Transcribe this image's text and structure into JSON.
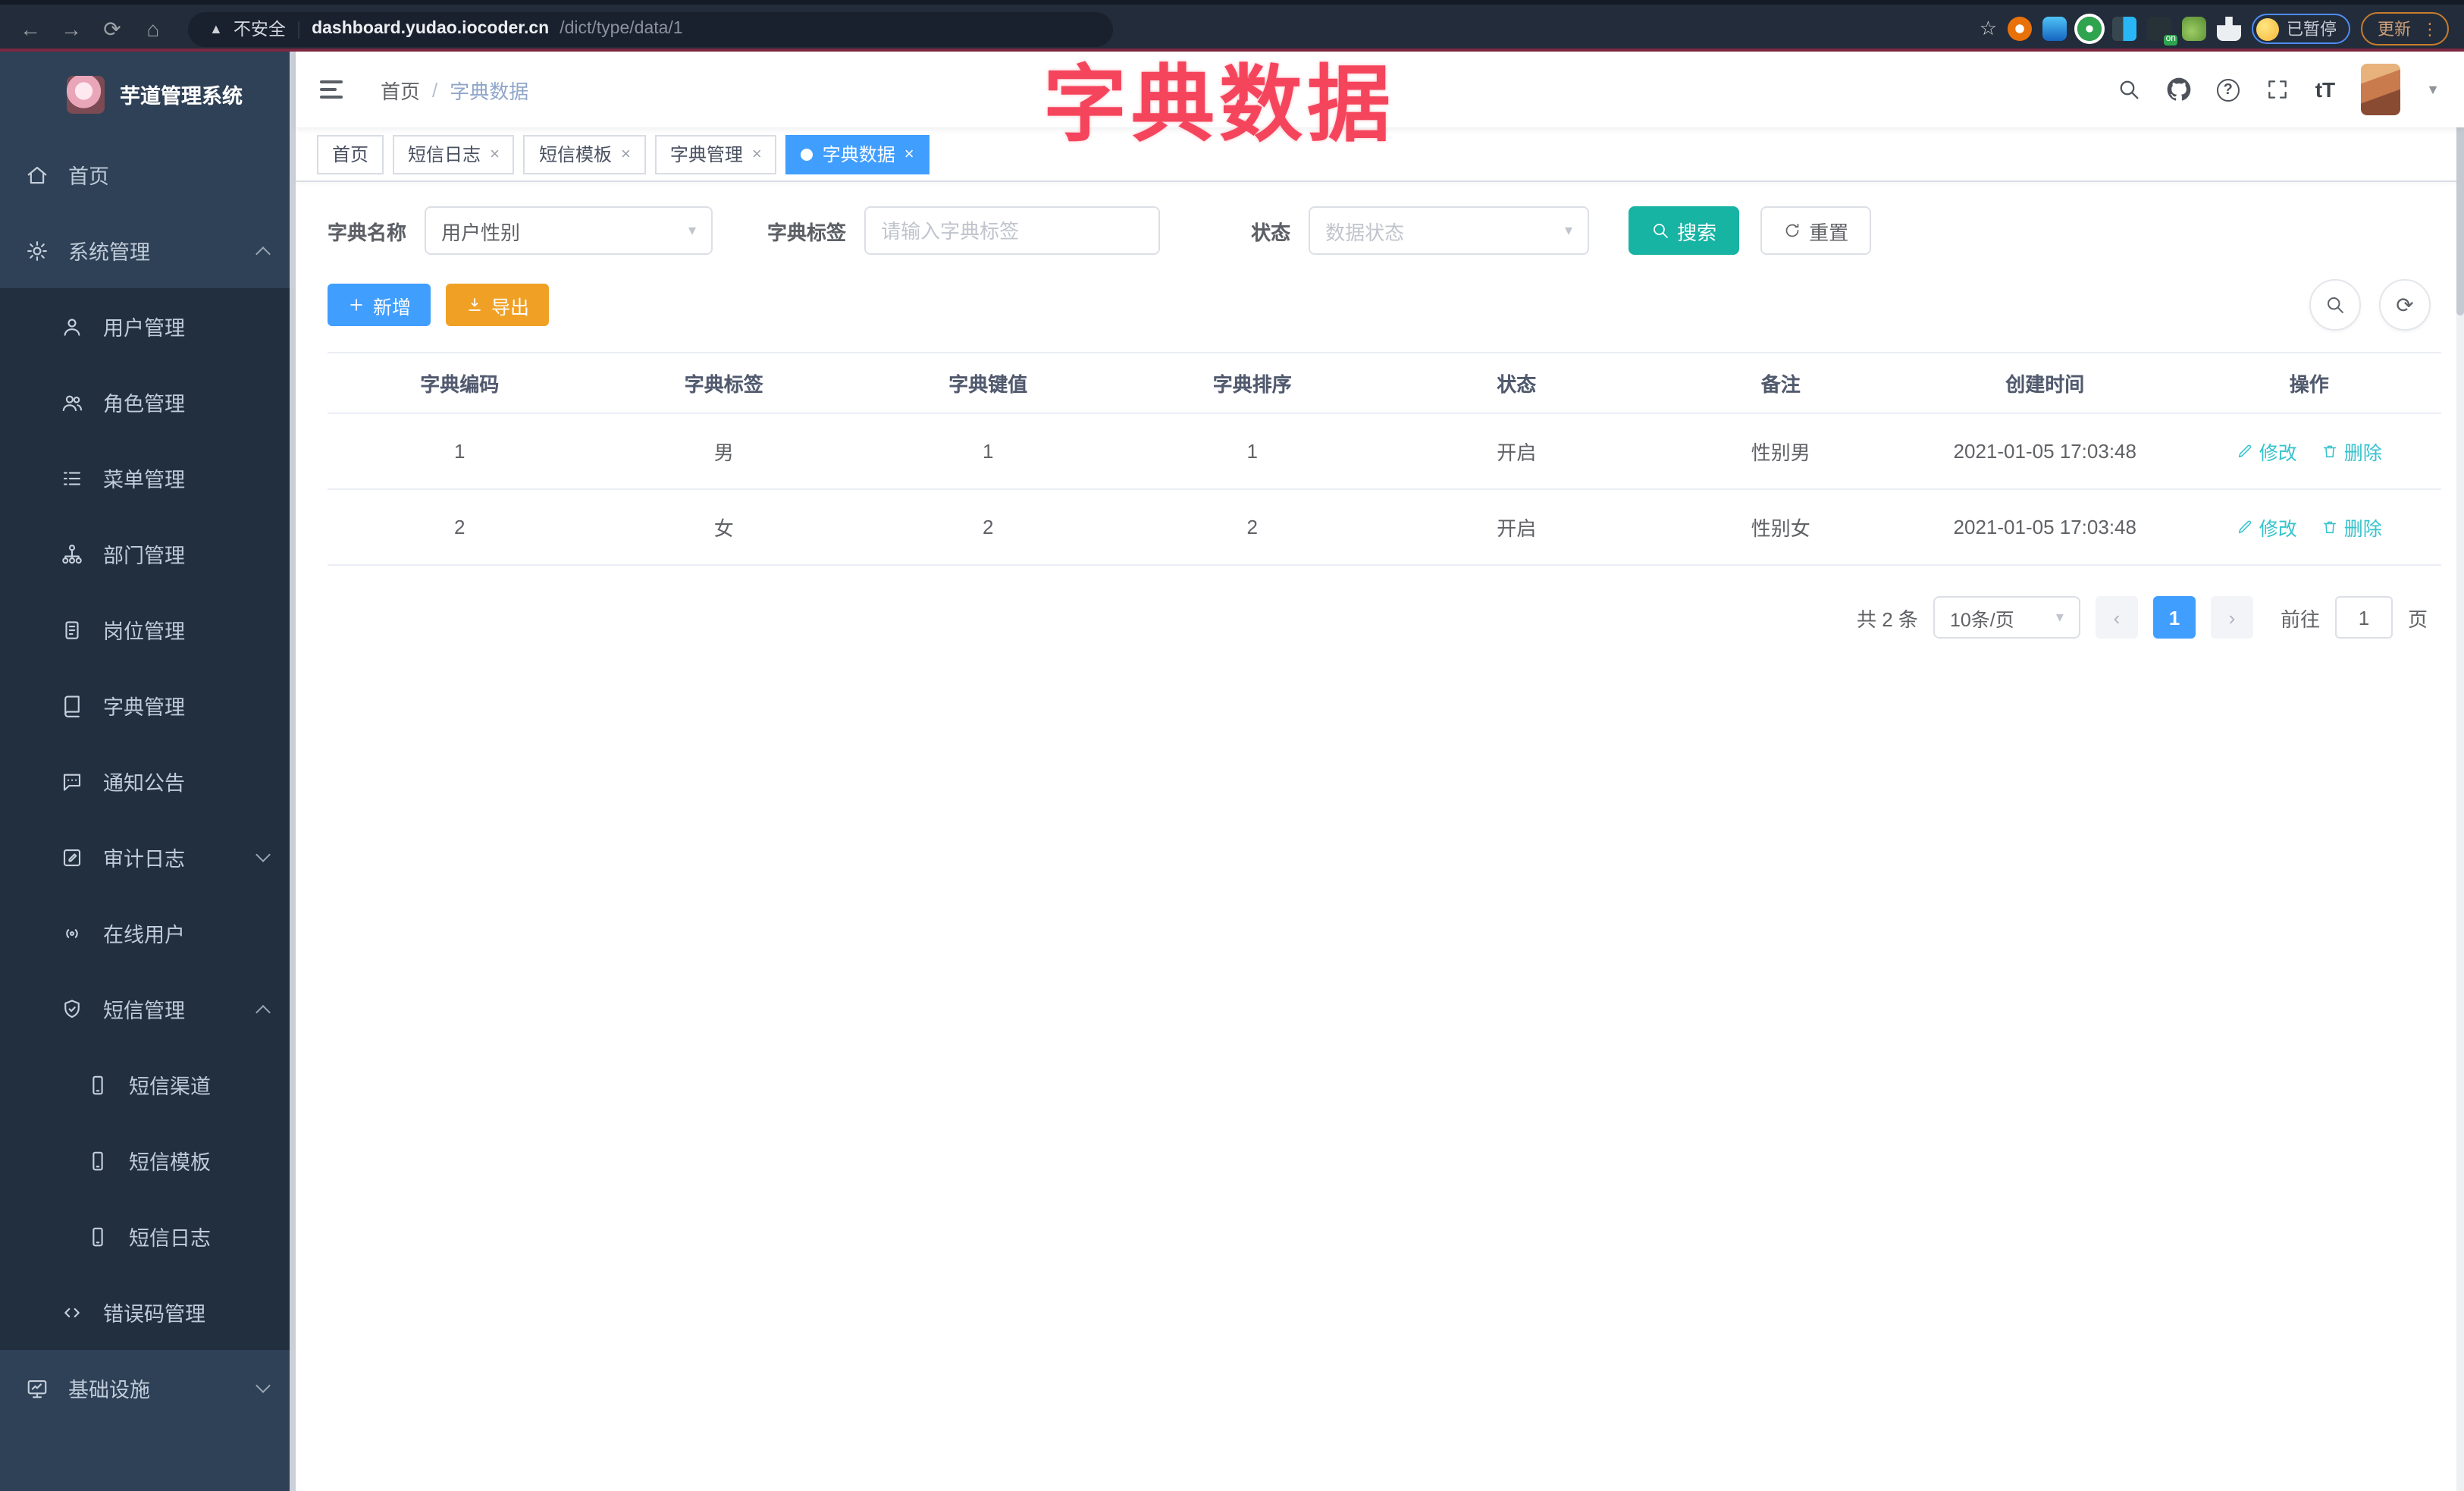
{
  "browser": {
    "security_label": "不安全",
    "url_host": "dashboard.yudao.iocoder.cn",
    "url_path": "/dict/type/data/1",
    "paused_badge": "已暂停",
    "update_button": "更新",
    "extension_badge": "on"
  },
  "icons": {
    "back": "←",
    "forward": "→",
    "reload": "⟳",
    "home": "⌂",
    "warning": "▲",
    "divider": "|",
    "star": "☆",
    "kebab": "⋮",
    "close": "×",
    "breadcrumb_sep": "/",
    "question": "?",
    "text_size": "tT",
    "caret": "▾",
    "avatar_caret": "▼",
    "plus": "+",
    "prev": "‹",
    "next": "›",
    "refresh": "⟳"
  },
  "overlay": {
    "title": "字典数据",
    "color": "#f5455c"
  },
  "sidebar": {
    "logo_title": "芋道管理系统",
    "items": [
      {
        "label": "首页"
      },
      {
        "label": "系统管理"
      },
      {
        "label": "用户管理"
      },
      {
        "label": "角色管理"
      },
      {
        "label": "菜单管理"
      },
      {
        "label": "部门管理"
      },
      {
        "label": "岗位管理"
      },
      {
        "label": "字典管理"
      },
      {
        "label": "通知公告"
      },
      {
        "label": "审计日志"
      },
      {
        "label": "在线用户"
      },
      {
        "label": "短信管理"
      },
      {
        "label": "短信渠道"
      },
      {
        "label": "短信模板"
      },
      {
        "label": "短信日志"
      },
      {
        "label": "错误码管理"
      },
      {
        "label": "基础设施"
      }
    ]
  },
  "navbar": {
    "breadcrumb": [
      "首页",
      "字典数据"
    ]
  },
  "tags_view": {
    "tabs": [
      {
        "label": "首页"
      },
      {
        "label": "短信日志"
      },
      {
        "label": "短信模板"
      },
      {
        "label": "字典管理"
      },
      {
        "label": "字典数据"
      }
    ]
  },
  "filters": {
    "dict_name_label": "字典名称",
    "dict_name_value": "用户性别",
    "dict_label_label": "字典标签",
    "dict_label_placeholder": "请输入字典标签",
    "status_label": "状态",
    "status_placeholder": "数据状态",
    "search_label": "搜索",
    "reset_label": "重置"
  },
  "toolbar": {
    "add_label": "新增",
    "export_label": "导出"
  },
  "table": {
    "headers": [
      "字典编码",
      "字典标签",
      "字典键值",
      "字典排序",
      "状态",
      "备注",
      "创建时间",
      "操作"
    ],
    "rows": [
      {
        "code": "1",
        "label": "男",
        "value": "1",
        "sort": "1",
        "status": "开启",
        "remark": "性别男",
        "created": "2021-01-05 17:03:48"
      },
      {
        "code": "2",
        "label": "女",
        "value": "2",
        "sort": "2",
        "status": "开启",
        "remark": "性别女",
        "created": "2021-01-05 17:03:48"
      }
    ],
    "edit_label": "修改",
    "delete_label": "删除"
  },
  "pagination": {
    "total_label": "共 2 条",
    "page_size_label": "10条/页",
    "current_page": "1",
    "goto_label": "前往",
    "goto_value": "1",
    "page_unit": "页"
  },
  "colors": {
    "primary_blue": "#409eff",
    "search_teal": "#17b3a3",
    "export_orange": "#f0a125",
    "sidebar_bg": "#2f4156",
    "submenu_bg": "#212f3f",
    "annotation_pink": "#f5455c",
    "action_link_teal": "#35c3cd"
  }
}
